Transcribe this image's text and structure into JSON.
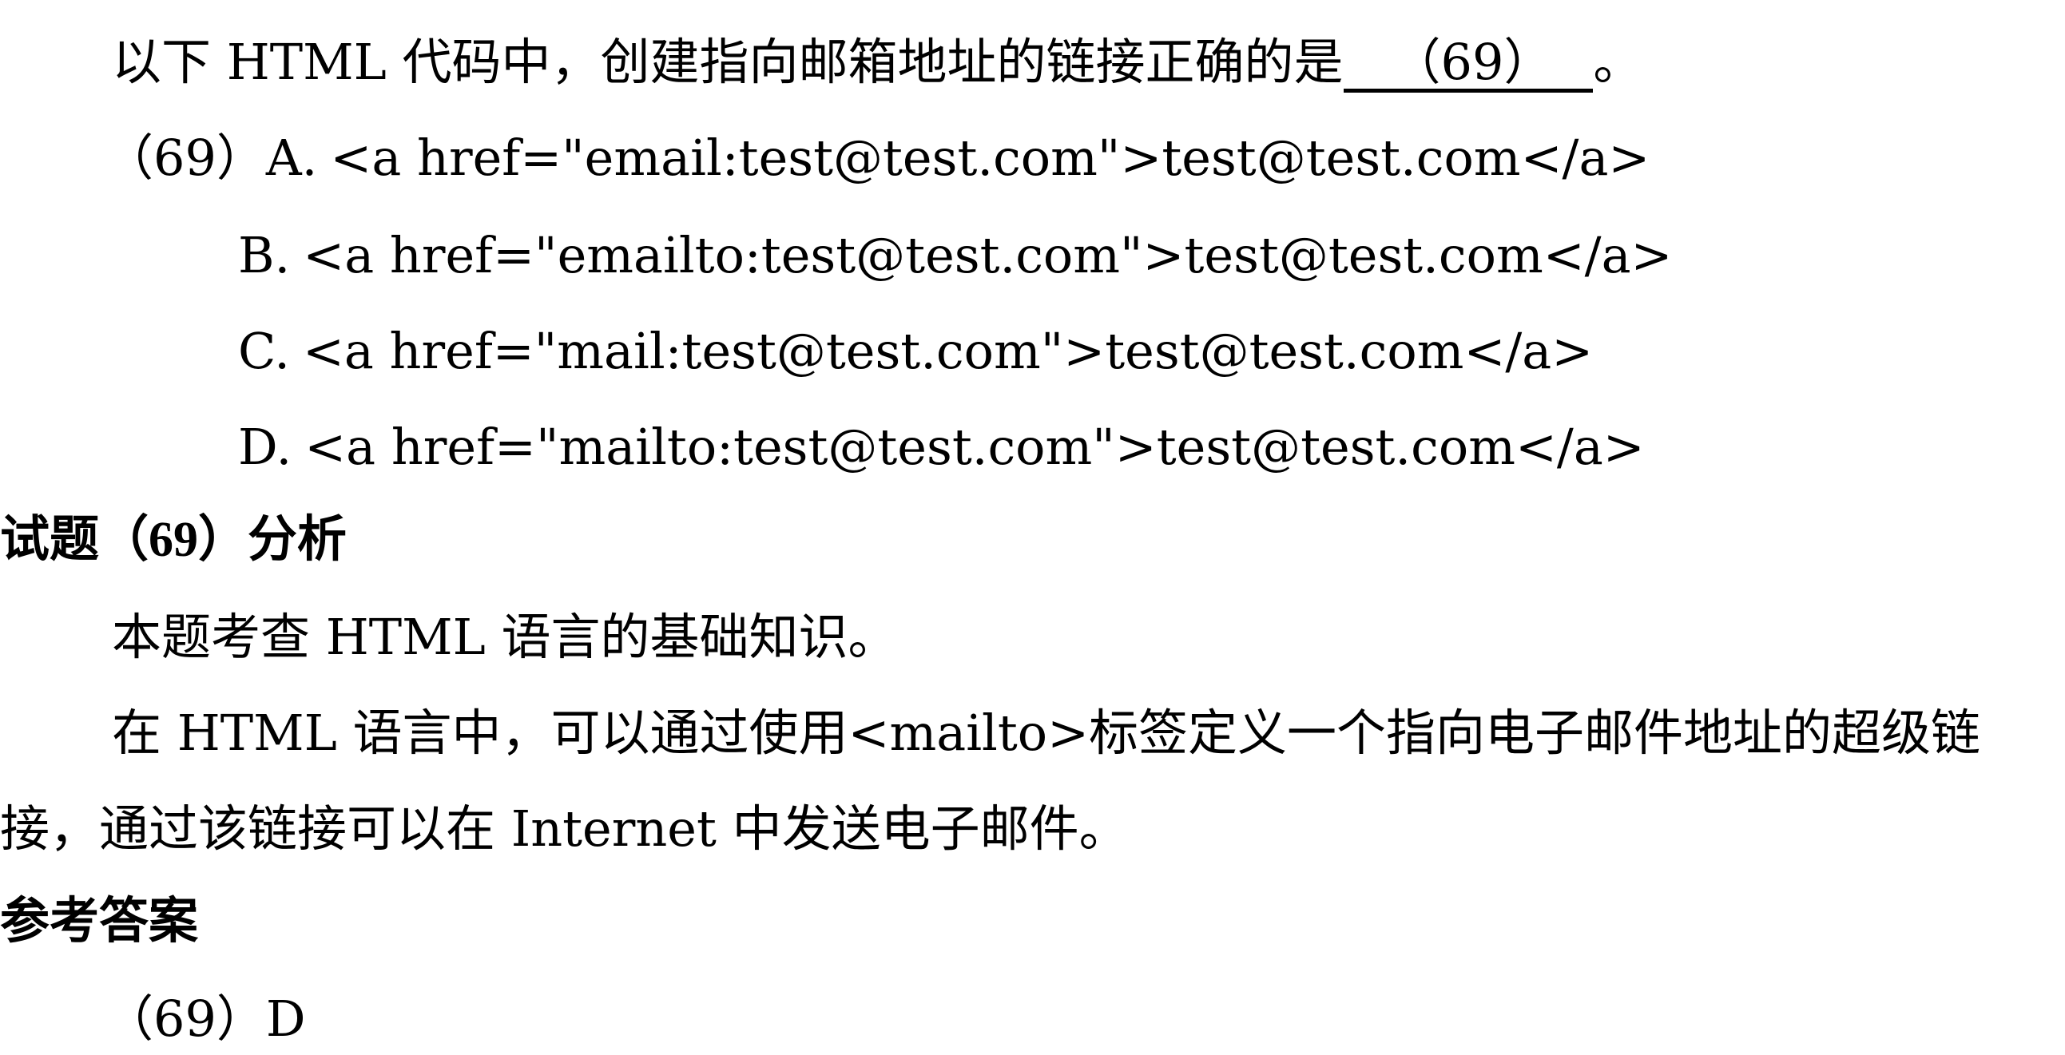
{
  "question": {
    "text_before": "以下 HTML 代码中，创建指向邮箱地址的链接正确的是",
    "blank": "（69）",
    "text_after": "。"
  },
  "options": [
    {
      "prefix": "（69）",
      "letter": "A.",
      "code": "<a href=\"email:test@test.com\">test@test.com</a>"
    },
    {
      "prefix": "",
      "letter": "B.",
      "code": "<a href=\"emailto:test@test.com\">test@test.com</a>"
    },
    {
      "prefix": "",
      "letter": "C.",
      "code": "<a href=\"mail:test@test.com\">test@test.com</a>"
    },
    {
      "prefix": "",
      "letter": "D.",
      "code": "<a href=\"mailto:test@test.com\">test@test.com</a>"
    }
  ],
  "analysis": {
    "heading_pre": "试题（",
    "heading_num": "69",
    "heading_post": "）分析",
    "para1": "本题考查 HTML 语言的基础知识。",
    "para2_line1": "在 HTML 语言中，可以通过使用<mailto>标签定义一个指向电子邮件地址的超级链",
    "para2_line2": "接，通过该链接可以在 Internet 中发送电子邮件。"
  },
  "answer": {
    "heading": "参考答案",
    "value": "（69）D"
  }
}
